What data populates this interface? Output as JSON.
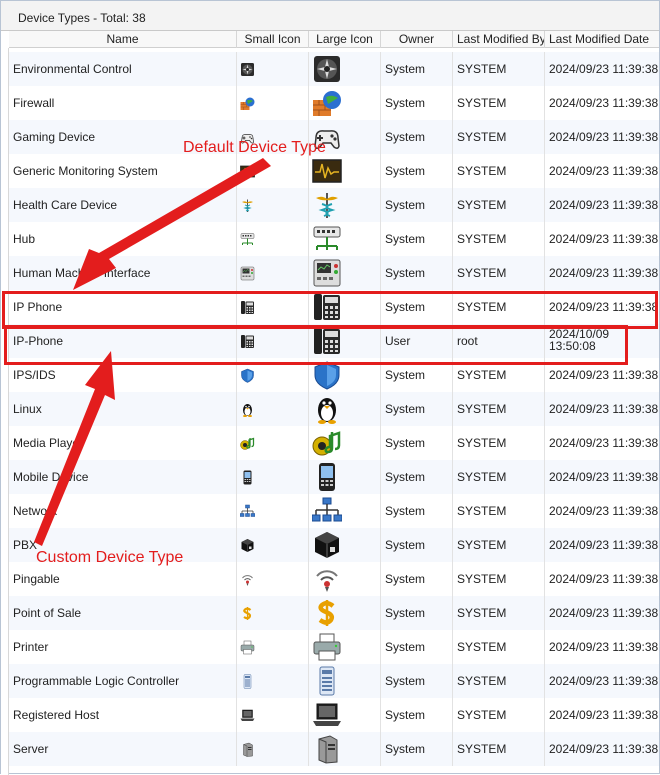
{
  "panel": {
    "title": "Device Types - Total: 38"
  },
  "columns": {
    "name": "Name",
    "small_icon": "Small Icon",
    "large_icon": "Large Icon",
    "owner": "Owner",
    "modified_by": "Last Modified By",
    "modified_date": "Last Modified Date"
  },
  "rows": [
    {
      "name": "Environmental Control",
      "icon": "environmental-control-icon",
      "owner": "System",
      "modified_by": "SYSTEM",
      "modified_date": "2024/09/23 11:39:38"
    },
    {
      "name": "Firewall",
      "icon": "firewall-icon",
      "owner": "System",
      "modified_by": "SYSTEM",
      "modified_date": "2024/09/23 11:39:38"
    },
    {
      "name": "Gaming Device",
      "icon": "gamepad-icon",
      "owner": "System",
      "modified_by": "SYSTEM",
      "modified_date": "2024/09/23 11:39:38"
    },
    {
      "name": "Generic Monitoring System",
      "icon": "monitoring-icon",
      "owner": "System",
      "modified_by": "SYSTEM",
      "modified_date": "2024/09/23 11:39:38"
    },
    {
      "name": "Health Care Device",
      "icon": "caduceus-icon",
      "owner": "System",
      "modified_by": "SYSTEM",
      "modified_date": "2024/09/23 11:39:38"
    },
    {
      "name": "Hub",
      "icon": "hub-icon",
      "owner": "System",
      "modified_by": "SYSTEM",
      "modified_date": "2024/09/23 11:39:38"
    },
    {
      "name": "Human Machine Interface",
      "icon": "hmi-panel-icon",
      "owner": "System",
      "modified_by": "SYSTEM",
      "modified_date": "2024/09/23 11:39:38"
    },
    {
      "name": "IP Phone",
      "icon": "ip-phone-icon",
      "owner": "System",
      "modified_by": "SYSTEM",
      "modified_date": "2024/09/23 11:39:38"
    },
    {
      "name": "IP-Phone",
      "icon": "ip-phone-icon",
      "owner": "User",
      "modified_by": "root",
      "modified_date_line1": "2024/10/09",
      "modified_date_line2": "13:50:08"
    },
    {
      "name": "IPS/IDS",
      "icon": "shield-icon",
      "owner": "System",
      "modified_by": "SYSTEM",
      "modified_date": "2024/09/23 11:39:38"
    },
    {
      "name": "Linux",
      "icon": "penguin-icon",
      "owner": "System",
      "modified_by": "SYSTEM",
      "modified_date": "2024/09/23 11:39:38"
    },
    {
      "name": "Media Player",
      "icon": "media-player-icon",
      "owner": "System",
      "modified_by": "SYSTEM",
      "modified_date": "2024/09/23 11:39:38"
    },
    {
      "name": "Mobile Device",
      "icon": "mobile-phone-icon",
      "owner": "System",
      "modified_by": "SYSTEM",
      "modified_date": "2024/09/23 11:39:38"
    },
    {
      "name": "Network",
      "icon": "network-icon",
      "owner": "System",
      "modified_by": "SYSTEM",
      "modified_date": "2024/09/23 11:39:38"
    },
    {
      "name": "PBX",
      "icon": "pbx-cube-icon",
      "owner": "System",
      "modified_by": "SYSTEM",
      "modified_date": "2024/09/23 11:39:38"
    },
    {
      "name": "Pingable",
      "icon": "ping-signal-icon",
      "owner": "System",
      "modified_by": "SYSTEM",
      "modified_date": "2024/09/23 11:39:38"
    },
    {
      "name": "Point of Sale",
      "icon": "dollar-icon",
      "owner": "System",
      "modified_by": "SYSTEM",
      "modified_date": "2024/09/23 11:39:38"
    },
    {
      "name": "Printer",
      "icon": "printer-icon",
      "owner": "System",
      "modified_by": "SYSTEM",
      "modified_date": "2024/09/23 11:39:38"
    },
    {
      "name": "Programmable Logic Controller",
      "icon": "plc-icon",
      "owner": "System",
      "modified_by": "SYSTEM",
      "modified_date": "2024/09/23 11:39:38"
    },
    {
      "name": "Registered Host",
      "icon": "laptop-icon",
      "owner": "System",
      "modified_by": "SYSTEM",
      "modified_date": "2024/09/23 11:39:38"
    },
    {
      "name": "Server",
      "icon": "server-tower-icon",
      "owner": "System",
      "modified_by": "SYSTEM",
      "modified_date": "2024/09/23 11:39:38"
    }
  ],
  "annotations": {
    "default_label": "Default Device Type",
    "custom_label": "Custom Device Type",
    "color": "#e31d1d"
  }
}
